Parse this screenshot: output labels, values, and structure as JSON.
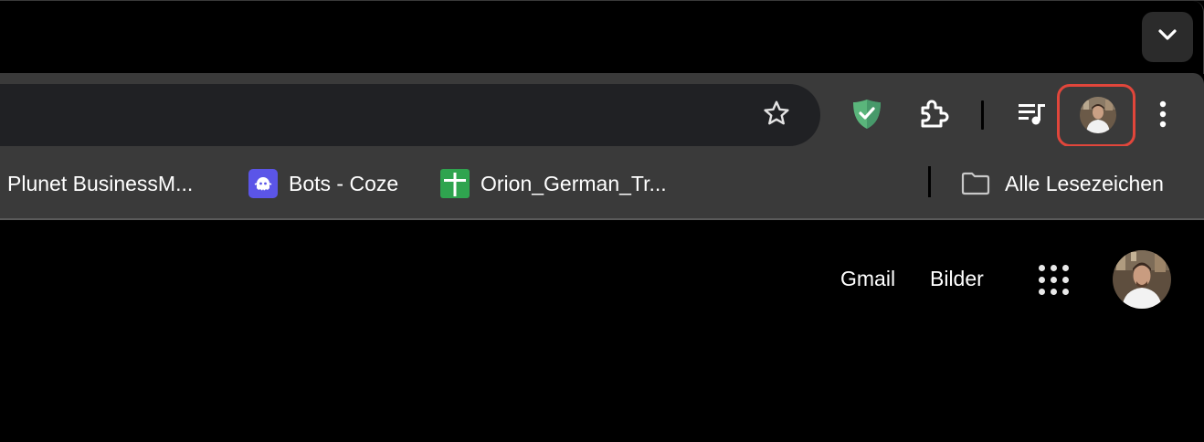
{
  "toolbar": {
    "bookmark_star_icon": "star-outline-icon",
    "extensions": [
      {
        "name": "adguard-shield-icon",
        "color": "#5ab57b"
      },
      {
        "name": "extensions-puzzle-icon"
      },
      {
        "name": "media-controls-icon"
      }
    ],
    "profile_highlight_color": "#e1463b",
    "menu_icon": "three-dots-vertical-icon"
  },
  "tabstrip": {
    "tab_search_icon": "chevron-down-icon"
  },
  "bookmarks": {
    "items": [
      {
        "label": "Plunet BusinessM..."
      },
      {
        "label": "Bots - Coze",
        "favicon_color": "#5b55e8",
        "favicon": "coze-ghost-icon"
      },
      {
        "label": "Orion_German_Tr...",
        "favicon_color": "#2fa44f",
        "favicon": "google-sheets-icon"
      }
    ],
    "all_bookmarks": {
      "label": "Alle Lesezeichen",
      "icon": "folder-icon"
    }
  },
  "page": {
    "links": {
      "gmail": "Gmail",
      "images": "Bilder"
    },
    "apps_icon": "apps-grid-icon"
  }
}
